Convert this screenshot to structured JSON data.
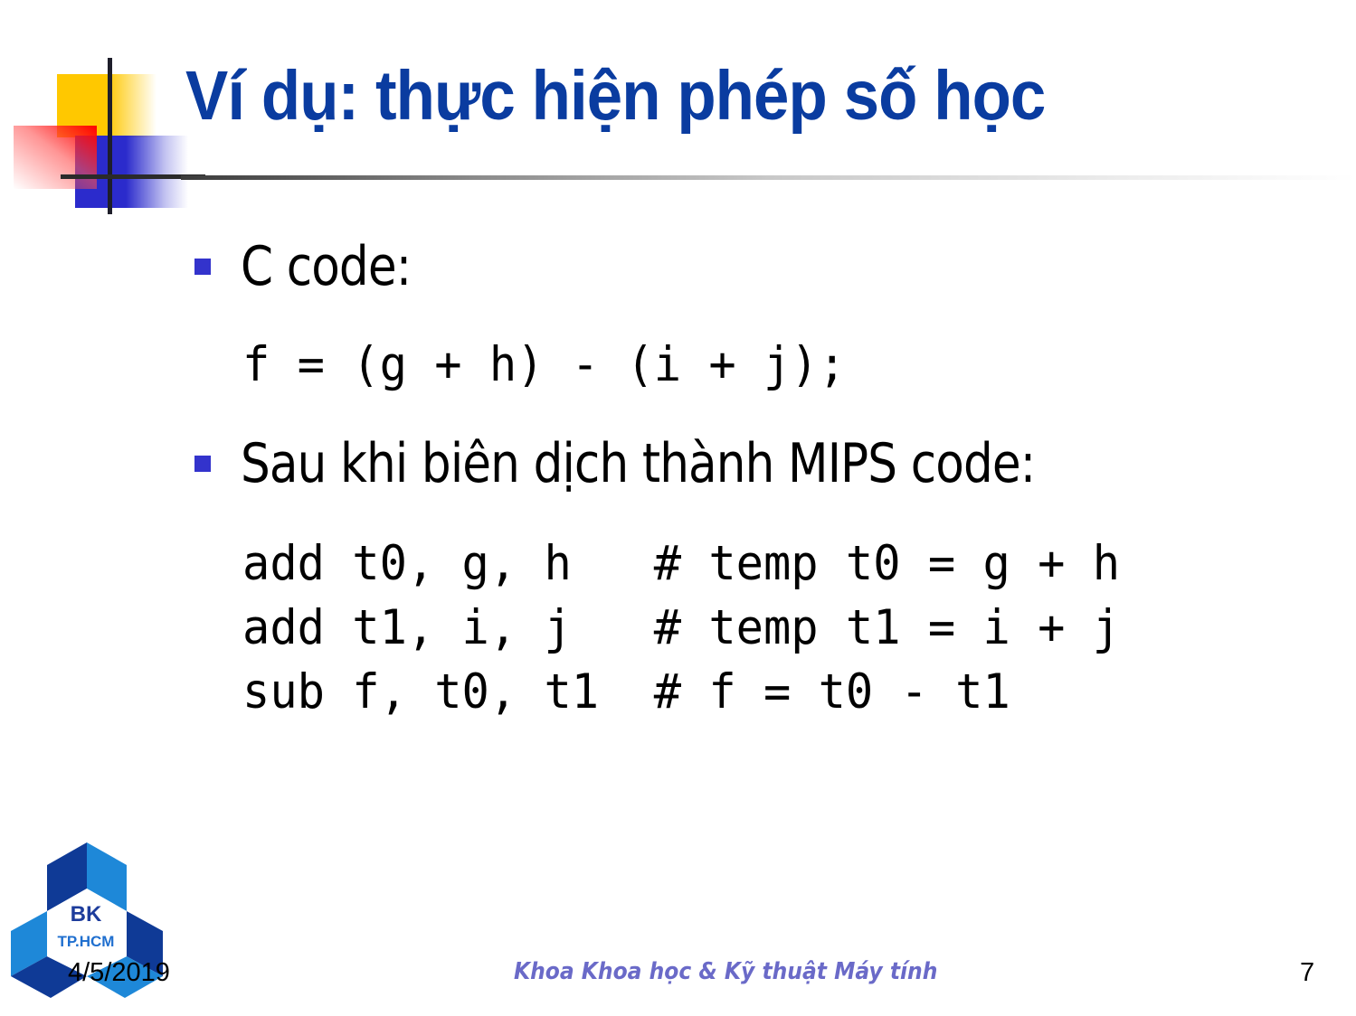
{
  "slide": {
    "title": "Ví dụ: thực hiện phép số học",
    "bullets": [
      {
        "label": "C code:",
        "code": "f = (g + h) - (i + j);"
      },
      {
        "label": "Sau khi biên dịch thành MIPS code:",
        "code": "add t0, g, h   # temp t0 = g + h\nadd t1, i, j   # temp t1 = i + j\nsub f, t0, t1  # f = t0 - t1"
      }
    ]
  },
  "footer": {
    "logo_line1": "BK",
    "logo_line2": "TP.HCM",
    "date": "4/5/2019",
    "center_text": "Khoa Khoa học & Kỹ thuật Máy tính",
    "page_number": "7"
  },
  "colors": {
    "title": "#0a3ca0",
    "bullet": "#3333cc",
    "footer_center": "#6a6ac8",
    "logo_dark": "#0f3a96",
    "logo_light": "#1e88d8"
  }
}
